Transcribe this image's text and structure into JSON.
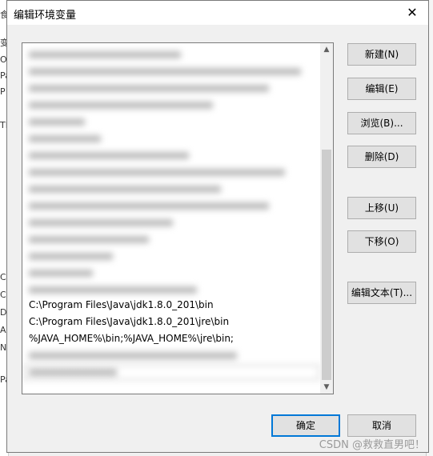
{
  "dialog": {
    "title": "编辑环境变量",
    "close_glyph": "✕"
  },
  "path_list": {
    "visible_entries": [
      "C:\\Program Files\\Java\\jdk1.8.0_201\\bin",
      "C:\\Program Files\\Java\\jdk1.8.0_201\\jre\\bin",
      "%JAVA_HOME%\\bin;%JAVA_HOME%\\jre\\bin;"
    ]
  },
  "buttons": {
    "new": "新建(N)",
    "edit": "编辑(E)",
    "browse": "浏览(B)...",
    "delete": "删除(D)",
    "move_up": "上移(U)",
    "move_down": "下移(O)",
    "edit_text": "编辑文本(T)...",
    "ok": "确定",
    "cancel": "取消"
  },
  "watermark": "CSDN @救救直男吧！",
  "colors": {
    "focus_border": "#0078d7",
    "button_face": "#e1e1e1"
  }
}
